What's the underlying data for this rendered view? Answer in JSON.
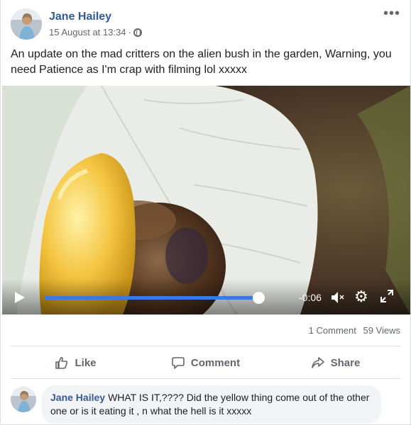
{
  "post": {
    "author": "Jane Hailey",
    "timestamp": "15 August at 13:34",
    "separator": "·",
    "more_label": "•••",
    "text": "An update on the mad critters on the alien bush in the garden, Warning, you need Patience as I'm crap with filming lol xxxxx"
  },
  "video": {
    "time_remaining": "-0:06",
    "progress": 0.97,
    "settings_glyph": "⚙"
  },
  "stats": {
    "comments": "1 Comment",
    "views": "59 Views"
  },
  "actions": {
    "like": "Like",
    "comment": "Comment",
    "share": "Share"
  },
  "comment": {
    "author": "Jane Hailey",
    "text": "WHAT IS IT,???? Did the yellow thing come out of the other one or is it eating it , n what the hell is it xxxxx"
  },
  "icons": {
    "more": "more-options-icon",
    "globe": "globe-icon",
    "play": "play-icon",
    "volume": "volume-muted-icon",
    "settings": "gear-icon",
    "fullscreen": "fullscreen-icon",
    "like": "thumbs-up-icon",
    "comment": "comment-bubble-icon",
    "share": "share-arrow-icon"
  },
  "colors": {
    "author_link": "#2f5b9a",
    "progress": "#3b78e7",
    "muted_text": "#606770"
  }
}
